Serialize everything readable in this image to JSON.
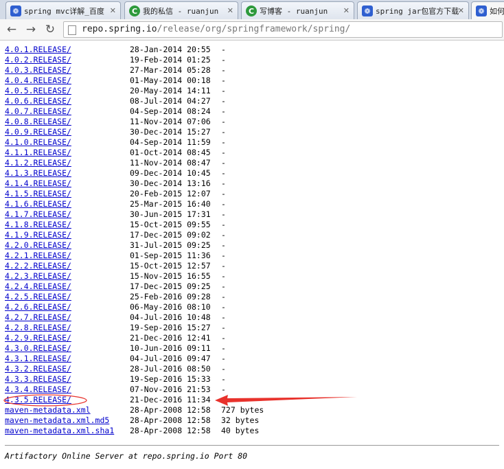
{
  "tabs": [
    {
      "title": "spring mvc详解_百度",
      "icon": "paw-icon",
      "active": false
    },
    {
      "title": "我的私信 - ruanjun",
      "icon": "csdn-icon",
      "active": false
    },
    {
      "title": "写博客 - ruanjun",
      "icon": "csdn-icon",
      "active": false
    },
    {
      "title": "spring jar包官方下载",
      "icon": "paw-icon",
      "active": false
    },
    {
      "title": "如何",
      "icon": "paw-icon",
      "active": true
    }
  ],
  "address": {
    "host": "repo.spring.io",
    "path": "/release/org/springframework/spring/"
  },
  "rows": [
    {
      "name": "4.0.1.RELEASE/",
      "date": "28-Jan-2014 20:55",
      "size": "-"
    },
    {
      "name": "4.0.2.RELEASE/",
      "date": "19-Feb-2014 01:25",
      "size": "-"
    },
    {
      "name": "4.0.3.RELEASE/",
      "date": "27-Mar-2014 05:28",
      "size": "-"
    },
    {
      "name": "4.0.4.RELEASE/",
      "date": "01-May-2014 00:18",
      "size": "-"
    },
    {
      "name": "4.0.5.RELEASE/",
      "date": "20-May-2014 14:11",
      "size": "-"
    },
    {
      "name": "4.0.6.RELEASE/",
      "date": "08-Jul-2014 04:27",
      "size": "-"
    },
    {
      "name": "4.0.7.RELEASE/",
      "date": "04-Sep-2014 08:24",
      "size": "-"
    },
    {
      "name": "4.0.8.RELEASE/",
      "date": "11-Nov-2014 07:06",
      "size": "-"
    },
    {
      "name": "4.0.9.RELEASE/",
      "date": "30-Dec-2014 15:27",
      "size": "-"
    },
    {
      "name": "4.1.0.RELEASE/",
      "date": "04-Sep-2014 11:59",
      "size": "-"
    },
    {
      "name": "4.1.1.RELEASE/",
      "date": "01-Oct-2014 08:45",
      "size": "-"
    },
    {
      "name": "4.1.2.RELEASE/",
      "date": "11-Nov-2014 08:47",
      "size": "-"
    },
    {
      "name": "4.1.3.RELEASE/",
      "date": "09-Dec-2014 10:45",
      "size": "-"
    },
    {
      "name": "4.1.4.RELEASE/",
      "date": "30-Dec-2014 13:16",
      "size": "-"
    },
    {
      "name": "4.1.5.RELEASE/",
      "date": "20-Feb-2015 12:07",
      "size": "-"
    },
    {
      "name": "4.1.6.RELEASE/",
      "date": "25-Mar-2015 16:40",
      "size": "-"
    },
    {
      "name": "4.1.7.RELEASE/",
      "date": "30-Jun-2015 17:31",
      "size": "-"
    },
    {
      "name": "4.1.8.RELEASE/",
      "date": "15-Oct-2015 09:55",
      "size": "-"
    },
    {
      "name": "4.1.9.RELEASE/",
      "date": "17-Dec-2015 09:02",
      "size": "-"
    },
    {
      "name": "4.2.0.RELEASE/",
      "date": "31-Jul-2015 09:25",
      "size": "-"
    },
    {
      "name": "4.2.1.RELEASE/",
      "date": "01-Sep-2015 11:36",
      "size": "-"
    },
    {
      "name": "4.2.2.RELEASE/",
      "date": "15-Oct-2015 12:57",
      "size": "-"
    },
    {
      "name": "4.2.3.RELEASE/",
      "date": "15-Nov-2015 16:55",
      "size": "-"
    },
    {
      "name": "4.2.4.RELEASE/",
      "date": "17-Dec-2015 09:25",
      "size": "-"
    },
    {
      "name": "4.2.5.RELEASE/",
      "date": "25-Feb-2016 09:28",
      "size": "-"
    },
    {
      "name": "4.2.6.RELEASE/",
      "date": "06-May-2016 08:10",
      "size": "-"
    },
    {
      "name": "4.2.7.RELEASE/",
      "date": "04-Jul-2016 10:48",
      "size": "-"
    },
    {
      "name": "4.2.8.RELEASE/",
      "date": "19-Sep-2016 15:27",
      "size": "-"
    },
    {
      "name": "4.2.9.RELEASE/",
      "date": "21-Dec-2016 12:41",
      "size": "-"
    },
    {
      "name": "4.3.0.RELEASE/",
      "date": "10-Jun-2016 09:11",
      "size": "-"
    },
    {
      "name": "4.3.1.RELEASE/",
      "date": "04-Jul-2016 09:47",
      "size": "-"
    },
    {
      "name": "4.3.2.RELEASE/",
      "date": "28-Jul-2016 08:50",
      "size": "-"
    },
    {
      "name": "4.3.3.RELEASE/",
      "date": "19-Sep-2016 15:33",
      "size": "-"
    },
    {
      "name": "4.3.4.RELEASE/",
      "date": "07-Nov-2016 21:53",
      "size": "-"
    },
    {
      "name": "4.3.5.RELEASE/",
      "date": "21-Dec-2016 11:34",
      "size": "-"
    },
    {
      "name": "maven-metadata.xml",
      "date": "28-Apr-2008 12:58",
      "size": "727 bytes"
    },
    {
      "name": "maven-metadata.xml.md5",
      "date": "28-Apr-2008 12:58",
      "size": "32 bytes"
    },
    {
      "name": "maven-metadata.xml.sha1",
      "date": "28-Apr-2008 12:58",
      "size": "40 bytes"
    }
  ],
  "footer": "Artifactory Online Server at repo.spring.io Port 80",
  "annotation_color": "#e8322c"
}
